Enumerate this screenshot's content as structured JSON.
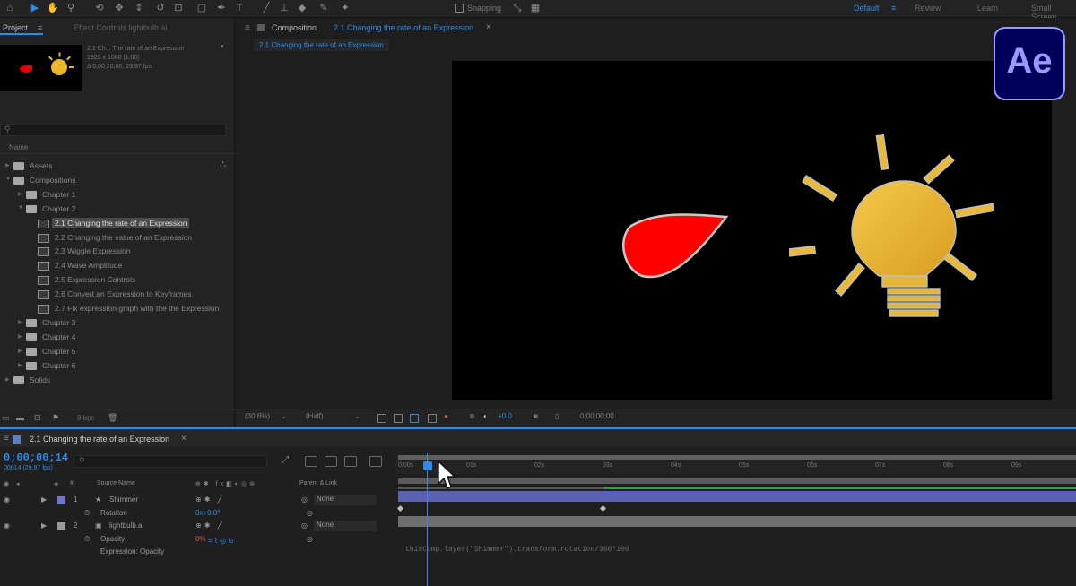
{
  "toolbar": {
    "snapping_label": "Snapping",
    "workspaces": [
      "Default",
      "Review",
      "Learn",
      "Small Screen"
    ],
    "active_workspace": "Default"
  },
  "project_panel": {
    "tabs": [
      "Project",
      "Effect Controls lightbulb.ai"
    ],
    "comp_info": [
      "2.1 Ch... The rate of an Expression",
      "1920 x 1080 (1.00)",
      "Δ 0;00;20;00, 29.97 fps"
    ],
    "column_name": "Name",
    "items": [
      {
        "type": "folder",
        "label": "Assets",
        "indent": 0,
        "expanded": false
      },
      {
        "type": "folder",
        "label": "Compositions",
        "indent": 0,
        "expanded": true
      },
      {
        "type": "folder",
        "label": "Chapter 1",
        "indent": 1,
        "expanded": false
      },
      {
        "type": "folder",
        "label": "Chapter 2",
        "indent": 1,
        "expanded": true
      },
      {
        "type": "comp",
        "label": "2.1 Changing the rate of an Expression",
        "indent": 2,
        "selected": true
      },
      {
        "type": "comp",
        "label": "2.2 Changing the value of an Expression",
        "indent": 2
      },
      {
        "type": "comp",
        "label": "2.3 Wiggle Expression",
        "indent": 2
      },
      {
        "type": "comp",
        "label": "2.4 Wave Amplitude",
        "indent": 2
      },
      {
        "type": "comp",
        "label": "2.5 Expression Controls",
        "indent": 2
      },
      {
        "type": "comp",
        "label": "2.6 Convert an Expression to Keyframes",
        "indent": 2
      },
      {
        "type": "comp",
        "label": "2.7 Fix expression graph with the the Expression",
        "indent": 2
      },
      {
        "type": "folder",
        "label": "Chapter 3",
        "indent": 1,
        "expanded": false
      },
      {
        "type": "folder",
        "label": "Chapter 4",
        "indent": 1,
        "expanded": false
      },
      {
        "type": "folder",
        "label": "Chapter 5",
        "indent": 1,
        "expanded": false
      },
      {
        "type": "folder",
        "label": "Chapter 6",
        "indent": 1,
        "expanded": false
      },
      {
        "type": "folder",
        "label": "Solids",
        "indent": 0,
        "expanded": false
      }
    ],
    "footer_bpc": "8 bpc"
  },
  "composition_panel": {
    "tab_label": "Composition",
    "tab_name": "2.1 Changing the rate of an Expression",
    "breadcrumb": "2.1 Changing the rate of an Expression",
    "footer": {
      "zoom": "(30.8%)",
      "resolution": "(Half)",
      "exposure": "+0.0",
      "timecode": "0;00;00;00"
    }
  },
  "app_logo": "Ae",
  "timeline": {
    "tab_label": "2.1 Changing the rate of an Expression",
    "current_time": "0;00;00;14",
    "frames_fps": "00014 (29.97 fps)",
    "columns": {
      "source_name": "Source Name",
      "parent_link": "Parent & Link"
    },
    "layers": [
      {
        "num": "1",
        "name": "Shimmer",
        "color": "#6f74d0",
        "parent": "None"
      },
      {
        "num": "",
        "name": "Rotation",
        "value": "0x+0.0°",
        "sub": true
      },
      {
        "num": "2",
        "name": "lightbulb.ai",
        "color": "#9a9a9a",
        "parent": "None"
      },
      {
        "num": "",
        "name": "Opacity",
        "value": "0%",
        "sub": true
      },
      {
        "num": "",
        "name": "Expression: Opacity",
        "sub2": true
      }
    ],
    "ruler_ticks": [
      "0:00s",
      "01s",
      "02s",
      "03s",
      "04s",
      "05s",
      "06s",
      "07s",
      "08s",
      "09s",
      "10s"
    ],
    "expression": "thisComp.layer(\"Shimmer\").transform.rotation/360*100"
  }
}
